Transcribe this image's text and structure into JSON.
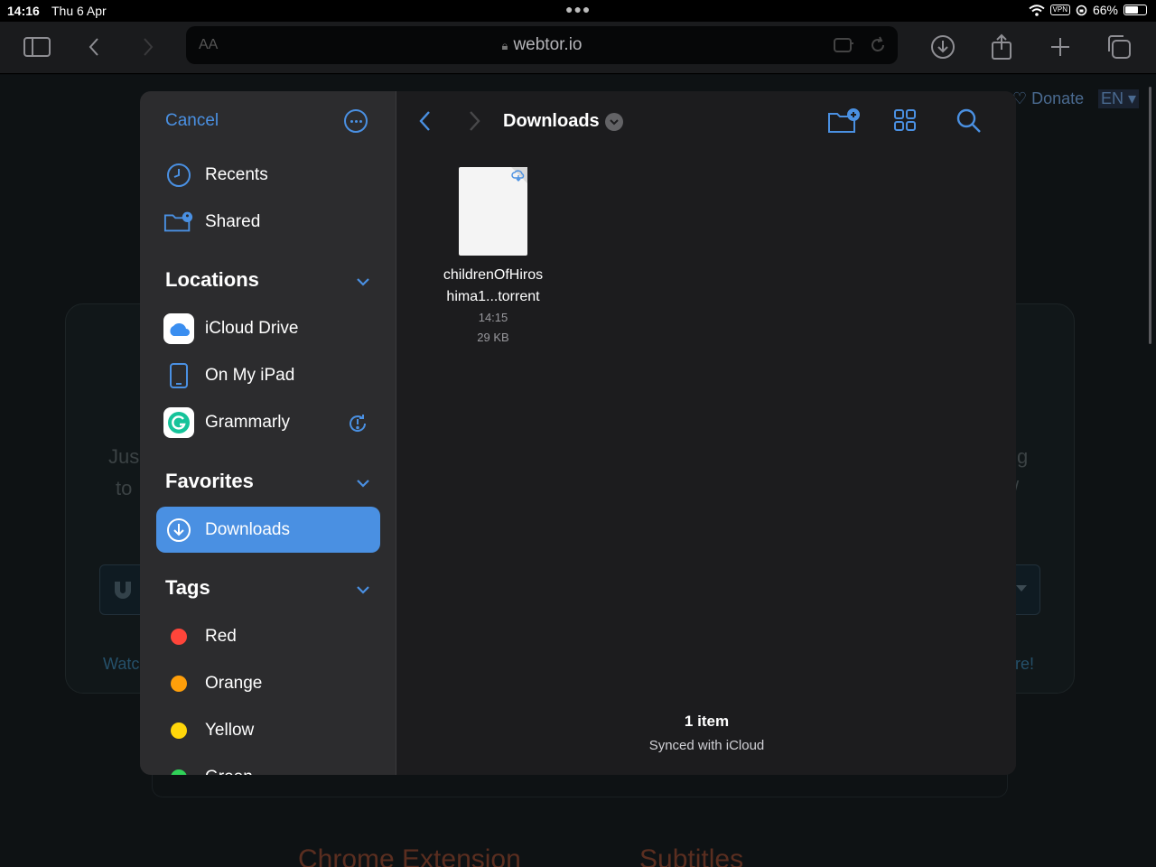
{
  "status_bar": {
    "time": "14:16",
    "date": "Thu 6 Apr",
    "vpn": "VPN",
    "battery_percent": "66%",
    "battery_level": 0.66
  },
  "browser": {
    "reader_label": "AA",
    "url": "webtor.io"
  },
  "page_background": {
    "donate": "♡ Donate",
    "language": "EN ▾",
    "text_left_1": "Jus",
    "text_left_2": "to",
    "text_right_1": "g",
    "text_right_2": "/",
    "link_left": "Watc",
    "link_right": "re!",
    "extension_title": "Chrome Extension",
    "subtitles_title": "Subtitles"
  },
  "picker": {
    "cancel_label": "Cancel",
    "sidebar": {
      "top_items": [
        {
          "label": "Recents",
          "icon": "clock-icon"
        },
        {
          "label": "Shared",
          "icon": "shared-folder-icon"
        }
      ],
      "locations_title": "Locations",
      "locations": [
        {
          "label": "iCloud Drive",
          "icon": "icloud-icon"
        },
        {
          "label": "On My iPad",
          "icon": "ipad-icon"
        },
        {
          "label": "Grammarly",
          "icon": "grammarly-icon"
        }
      ],
      "favorites_title": "Favorites",
      "favorites": [
        {
          "label": "Downloads",
          "icon": "download-circle-icon",
          "selected": true
        }
      ],
      "tags_title": "Tags",
      "tags": [
        {
          "label": "Red",
          "color": "#ff453a"
        },
        {
          "label": "Orange",
          "color": "#ff9f0a"
        },
        {
          "label": "Yellow",
          "color": "#ffd60a"
        },
        {
          "label": "Green",
          "color": "#30d158"
        }
      ]
    },
    "main": {
      "folder_title": "Downloads",
      "file": {
        "name_line1": "childrenOfHiros",
        "name_line2": "hima1...torrent",
        "time": "14:15",
        "size": "29 KB"
      },
      "item_count": "1 item",
      "sync_status": "Synced with iCloud"
    },
    "accent_color": "#4a90e2"
  }
}
